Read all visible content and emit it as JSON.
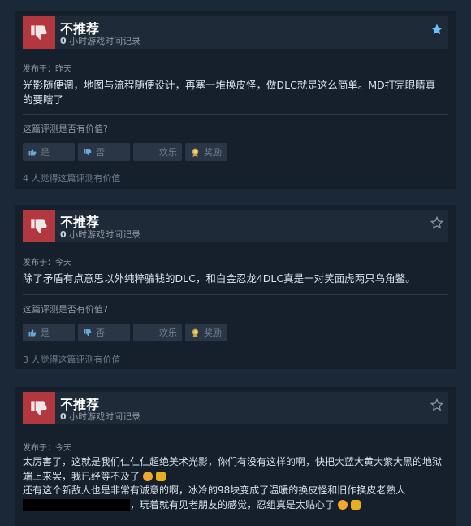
{
  "reviews": [
    {
      "verdict": "不推荐",
      "hours_value": "0",
      "hours_label": "小时游戏时间记录",
      "posted": "发布于：昨天",
      "text": "光影随便调，地图与流程随便设计，再塞一堆换皮怪，做DLC就是这么简单。MD打完眼睛真的要瞎了",
      "favorited": true,
      "helpful_q": "这篇评测是否有价值?",
      "yes": "是",
      "no": "否",
      "funny": "欢乐",
      "award": "奖励",
      "count": "4 人觉得这篇评测有价值"
    },
    {
      "verdict": "不推荐",
      "hours_value": "0",
      "hours_label": "小时游戏时间记录",
      "posted": "发布于：今天",
      "text": "除了矛盾有点意思以外纯粹骗钱的DLC，和白金忍龙4DLC真是一对笑面虎两只乌角鳖。",
      "favorited": false,
      "helpful_q": "这篇评测是否有价值?",
      "yes": "是",
      "no": "否",
      "funny": "欢乐",
      "award": "奖励",
      "count": "3 人觉得这篇评测有价值"
    },
    {
      "verdict": "不推荐",
      "hours_value": "0",
      "hours_label": "小时游戏时间记录",
      "posted": "发布于：今天",
      "text_line1": "太厉害了，这就是我们仁仁仁超绝美术光影，你们有没有这样的啊，快把大蓝大黄大紫大黑的地狱端上来罢，我已经等不及了",
      "text_line2": "还有这个新敌人也是非常有诚意的啊，冰冷的98块变成了温暖的换皮怪和旧作换皮老熟人",
      "text_line3": "，玩着就有见老朋友的感觉，忍组真是太贴心了",
      "favorited": false
    }
  ],
  "colors": {
    "background": "#1b2838",
    "card": "#16202d",
    "thumb_down_bg": "#b3373f",
    "star_active": "#67c1f5"
  },
  "icons": {
    "thumb": "thumbs-down-icon",
    "star": "star-icon",
    "yes": "thumbs-up-icon",
    "no": "thumbs-down-icon",
    "award": "award-icon"
  }
}
